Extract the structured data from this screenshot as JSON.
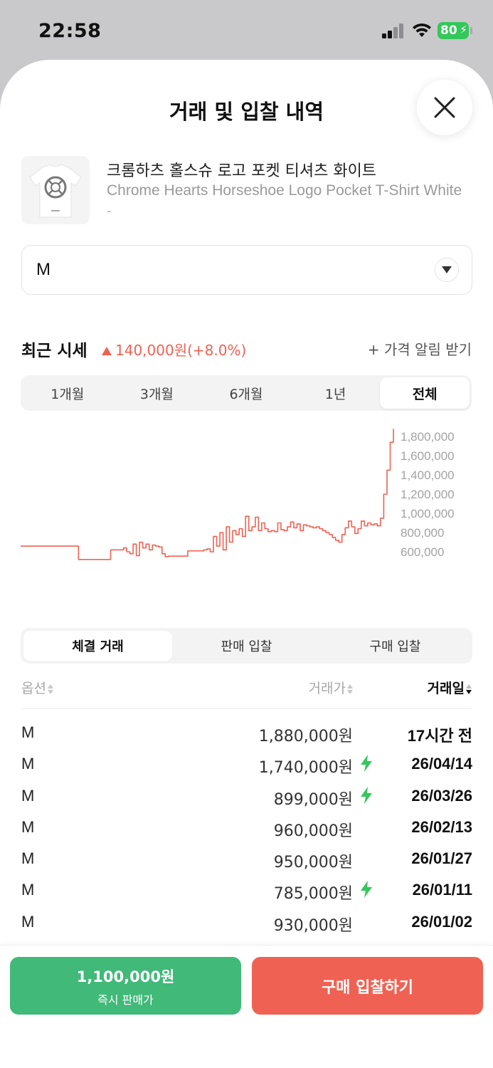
{
  "status_bar": {
    "time": "22:58",
    "battery": "80"
  },
  "sheet": {
    "title": "거래 및 입찰 내역"
  },
  "product": {
    "name_ko": "크롬하츠 홀스슈 로고 포켓 티셔츠 화이트",
    "name_en": "Chrome Hearts Horseshoe Logo Pocket T-Shirt White",
    "sub": "-"
  },
  "size_select": {
    "value": "M"
  },
  "recent": {
    "label": "최근 시세",
    "change": "140,000원(+8.0%)",
    "direction": "up",
    "alert_label": "+ 가격 알림 받기"
  },
  "period_tabs": [
    "1개월",
    "3개월",
    "6개월",
    "1년",
    "전체"
  ],
  "period_active": "전체",
  "chart_data": {
    "type": "line",
    "y_ticks": [
      "1,800,000",
      "1,600,000",
      "1,400,000",
      "1,200,000",
      "1,000,000",
      "800,000",
      "600,000"
    ],
    "ylim": [
      600000,
      1800000
    ],
    "line_color": "#ef6253",
    "series": [
      {
        "values": [
          660000,
          660000,
          660000,
          660000,
          660000,
          660000,
          660000,
          660000,
          660000,
          660000,
          660000,
          660000,
          660000,
          660000,
          660000,
          660000,
          660000,
          660000,
          520000,
          520000,
          520000,
          520000,
          520000,
          520000,
          520000,
          520000,
          520000,
          520000,
          620000,
          620000,
          620000,
          620000,
          640000,
          600000,
          580000,
          680000,
          560000,
          700000,
          640000,
          680000,
          620000,
          670000,
          660000,
          650000,
          580000,
          550000,
          555000,
          555000,
          555000,
          555000,
          555000,
          555000,
          610000,
          610000,
          610000,
          610000,
          610000,
          620000,
          630000,
          600000,
          760000,
          660000,
          800000,
          620000,
          860000,
          700000,
          820000,
          780000,
          840000,
          760000,
          970000,
          820000,
          860000,
          960000,
          820000,
          900000,
          840000,
          810000,
          820000,
          810000,
          900000,
          830000,
          820000,
          860000,
          910000,
          850000,
          890000,
          820000,
          880000,
          870000,
          860000,
          850000,
          860000,
          840000,
          820000,
          800000,
          780000,
          750000,
          720000,
          700000,
          780000,
          850000,
          920000,
          860000,
          790000,
          840000,
          920000,
          870000,
          900000,
          880000,
          890000,
          870000,
          950000,
          1200000,
          1450000,
          1740000,
          1880000
        ]
      }
    ]
  },
  "history_tabs": [
    "체결 거래",
    "판매 입찰",
    "구매 입찰"
  ],
  "history_active": "체결 거래",
  "table": {
    "headers": {
      "option": "옵션",
      "price": "거래가",
      "date": "거래일"
    },
    "rows": [
      {
        "option": "M",
        "price": "1,880,000원",
        "quick": false,
        "date": "17시간 전"
      },
      {
        "option": "M",
        "price": "1,740,000원",
        "quick": true,
        "date": "26/04/14"
      },
      {
        "option": "M",
        "price": "899,000원",
        "quick": true,
        "date": "26/03/26"
      },
      {
        "option": "M",
        "price": "960,000원",
        "quick": false,
        "date": "26/02/13"
      },
      {
        "option": "M",
        "price": "950,000원",
        "quick": false,
        "date": "26/01/27"
      },
      {
        "option": "M",
        "price": "785,000원",
        "quick": true,
        "date": "26/01/11"
      },
      {
        "option": "M",
        "price": "930,000원",
        "quick": false,
        "date": "26/01/02"
      }
    ]
  },
  "actions": {
    "sell_price": "1,100,000원",
    "sell_label": "즉시 판매가",
    "buy_label": "구매 입찰하기"
  },
  "colors": {
    "sell": "#41b979",
    "buy": "#ef6253",
    "quick_bolt": "#34c759"
  }
}
